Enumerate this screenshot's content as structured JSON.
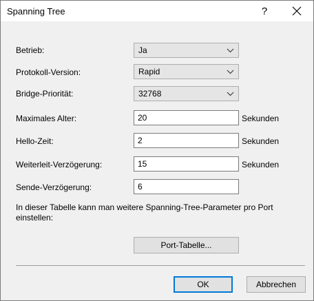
{
  "dialog": {
    "title": "Spanning Tree",
    "help_label": "?"
  },
  "fields": {
    "betrieb": {
      "label": "Betrieb:",
      "value": "Ja"
    },
    "protokoll": {
      "label": "Protokoll-Version:",
      "value": "Rapid"
    },
    "prioritaet": {
      "label": "Bridge-Priorität:",
      "value": "32768"
    },
    "max_alter": {
      "label": "Maximales Alter:",
      "value": "20",
      "unit": "Sekunden"
    },
    "hello": {
      "label": "Hello-Zeit:",
      "value": "2",
      "unit": "Sekunden"
    },
    "weiterleit": {
      "label": "Weiterleit-Verzögerung:",
      "value": "15",
      "unit": "Sekunden"
    },
    "sende": {
      "label": "Sende-Verzögerung:",
      "value": "6"
    }
  },
  "info_text": "In dieser Tabelle kann man weitere Spanning-Tree-Parameter pro Port einstellen:",
  "buttons": {
    "port_table": "Port-Tabelle...",
    "ok": "OK",
    "cancel": "Abbrechen"
  },
  "icons": {
    "close": "close-icon",
    "dropdown": "chevron-down-icon"
  }
}
